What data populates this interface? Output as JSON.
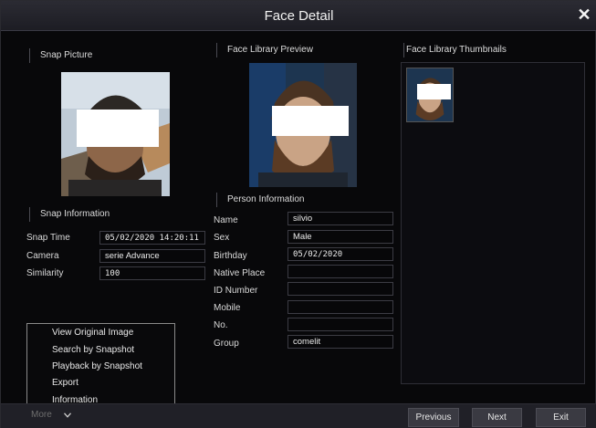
{
  "window": {
    "title": "Face Detail"
  },
  "snap": {
    "section_label": "Snap Picture",
    "info_label": "Snap Information",
    "fields": [
      {
        "label": "Snap Time",
        "value": "05/02/2020 14:20:11"
      },
      {
        "label": "Camera",
        "value": "serie Advance"
      },
      {
        "label": "Similarity",
        "value": "100"
      }
    ]
  },
  "library": {
    "preview_label": "Face Library Preview",
    "thumbnails_label": "Face Library Thumbnails",
    "person_label": "Person Information",
    "fields": [
      {
        "label": "Name",
        "value": "silvio"
      },
      {
        "label": "Sex",
        "value": "Male"
      },
      {
        "label": "Birthday",
        "value": "05/02/2020"
      },
      {
        "label": "Native Place",
        "value": ""
      },
      {
        "label": "ID Number",
        "value": ""
      },
      {
        "label": "Mobile",
        "value": ""
      },
      {
        "label": "No.",
        "value": ""
      },
      {
        "label": "Group",
        "value": "comelit"
      }
    ]
  },
  "menu": {
    "items": [
      "View Original Image",
      "Search by Snapshot",
      "Playback by Snapshot",
      "Export",
      "Information"
    ]
  },
  "bottom": {
    "more_label": "More",
    "previous_label": "Previous",
    "next_label": "Next",
    "exit_label": "Exit"
  },
  "icons": {
    "close": "close-icon",
    "chevron": "chevron-down-icon"
  },
  "colors": {
    "background": "#08080a",
    "titlebar": "#24242b",
    "button": "#3a3a42",
    "field_border": "#3c3c44"
  }
}
